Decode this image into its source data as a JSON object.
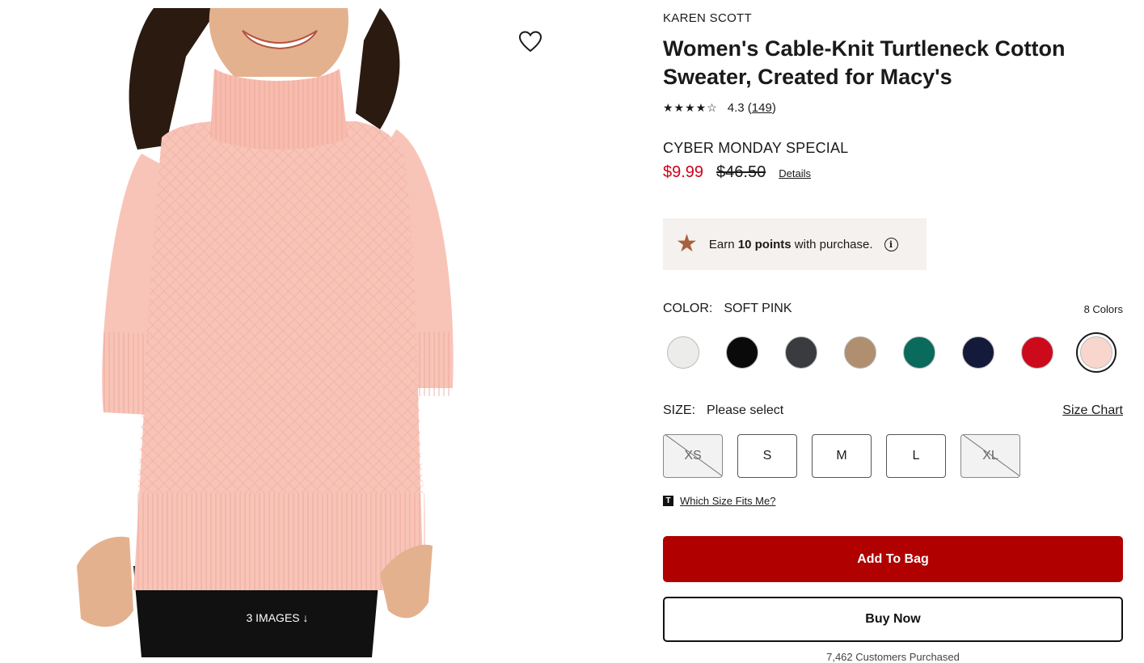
{
  "product": {
    "brand": "KAREN SCOTT",
    "title": "Women's Cable-Knit Turtleneck Cotton Sweater, Created for Macy's",
    "rating": {
      "stars": "★★★★☆",
      "value": "4.3",
      "count": "149"
    },
    "promo_label": "CYBER MONDAY SPECIAL",
    "sale_price": "$9.99",
    "original_price": "$46.50",
    "details_link": "Details"
  },
  "points": {
    "prefix": "Earn",
    "amount": "10 points",
    "suffix": "with purchase."
  },
  "color": {
    "label": "COLOR:",
    "selected": "SOFT PINK",
    "count": "8 Colors",
    "swatches": [
      {
        "name": "ivory",
        "hex": "#ececea"
      },
      {
        "name": "black",
        "hex": "#0a0a0a"
      },
      {
        "name": "charcoal",
        "hex": "#3a3b3e"
      },
      {
        "name": "camel",
        "hex": "#b08e70"
      },
      {
        "name": "teal",
        "hex": "#0a6a5c"
      },
      {
        "name": "navy",
        "hex": "#141a3a"
      },
      {
        "name": "red",
        "hex": "#cc0a1c"
      },
      {
        "name": "soft-pink",
        "hex": "#f8d6ce"
      }
    ]
  },
  "size": {
    "label": "SIZE:",
    "selected": "Please select",
    "chart_link": "Size Chart",
    "options": [
      {
        "label": "XS",
        "available": false
      },
      {
        "label": "S",
        "available": true
      },
      {
        "label": "M",
        "available": true
      },
      {
        "label": "L",
        "available": true
      },
      {
        "label": "XL",
        "available": false
      }
    ]
  },
  "fit_link": "Which Size Fits Me?",
  "fit_icon_letter": "T",
  "actions": {
    "add_to_bag": "Add To Bag",
    "buy_now": "Buy Now"
  },
  "purchased_text": "7,462 Customers Purchased",
  "gallery": {
    "count_label": "3 IMAGES ↓"
  },
  "colors": {
    "sale": "#d0021b",
    "primary_button": "#b00000",
    "points_star": "#a9603b",
    "points_bg": "#f4f1ef"
  }
}
